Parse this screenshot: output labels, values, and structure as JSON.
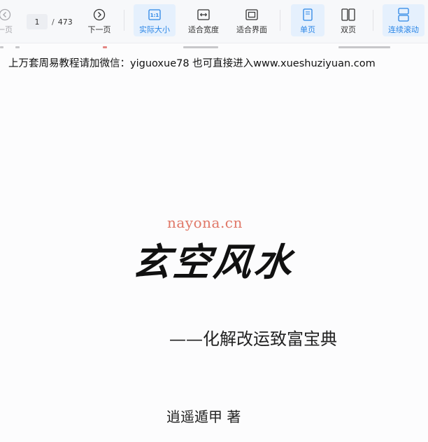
{
  "toolbar": {
    "prev_page_label": "一页",
    "next_page_label": "下一页",
    "current_page": "1",
    "page_separator": "/",
    "total_pages": "473",
    "actual_size_label": "实际大小",
    "fit_width_label": "适合宽度",
    "fit_page_label": "适合界面",
    "single_page_label": "单页",
    "double_page_label": "双页",
    "continuous_scroll_label": "连续滚动",
    "accent_color": "#2b86e6",
    "icons": {
      "prev": "chevron-left-circle-icon",
      "next": "chevron-right-circle-icon",
      "actual_size": "one-to-one-icon",
      "fit_width": "fit-width-icon",
      "fit_page": "fit-page-icon",
      "single_page": "single-page-icon",
      "double_page": "double-page-icon",
      "continuous_scroll": "continuous-scroll-icon"
    }
  },
  "document": {
    "header_text": "上万套周易教程请加微信：yiguoxue78  也可直接进入www.xueshuziyuan.com",
    "watermark": "nayona.cn",
    "title": "玄空风水",
    "subtitle": "——化解改运致富宝典",
    "author": "逍遥遁甲 著"
  }
}
